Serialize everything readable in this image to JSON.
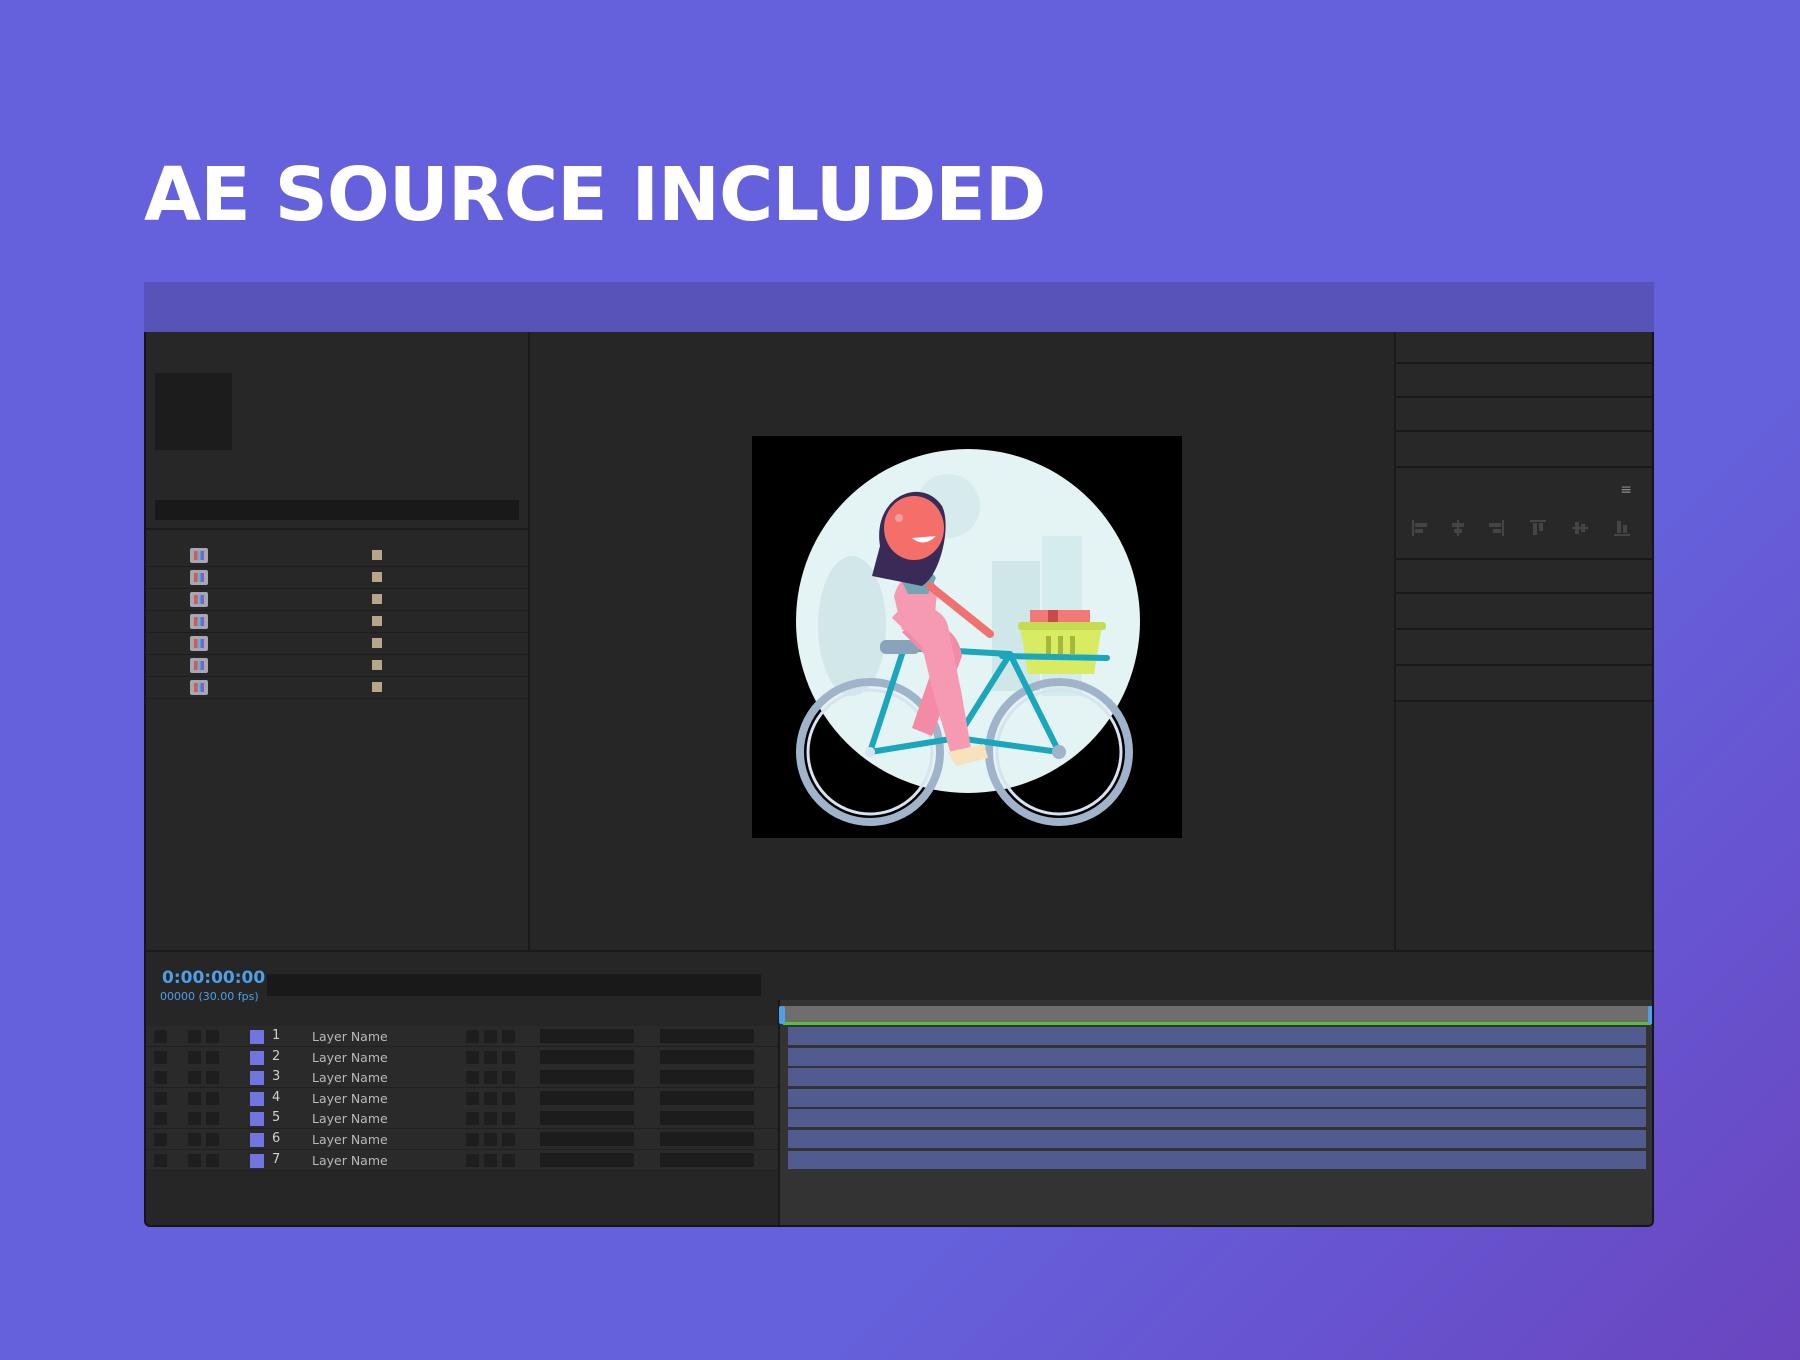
{
  "headline": "AE SOURCE INCLUDED",
  "colors": {
    "background": "#6561dc",
    "timecode": "#4d9fea",
    "layer_label": "#7175e0",
    "layer_bar": "#525b90",
    "work_area_line": "#5bbf3a"
  },
  "project_panel": {
    "items": [
      {
        "icon": "composition-icon"
      },
      {
        "icon": "composition-icon"
      },
      {
        "icon": "composition-icon"
      },
      {
        "icon": "composition-icon"
      },
      {
        "icon": "composition-icon"
      },
      {
        "icon": "composition-icon"
      },
      {
        "icon": "composition-icon"
      }
    ]
  },
  "right_panel": {
    "menu_icon": "≡"
  },
  "timeline": {
    "timecode": "0:00:00:00",
    "frames": "00000 (30.00 fps)",
    "layers": [
      {
        "num": "1",
        "name": "Layer Name"
      },
      {
        "num": "2",
        "name": "Layer Name"
      },
      {
        "num": "3",
        "name": "Layer Name"
      },
      {
        "num": "4",
        "name": "Layer Name"
      },
      {
        "num": "5",
        "name": "Layer Name"
      },
      {
        "num": "6",
        "name": "Layer Name"
      },
      {
        "num": "7",
        "name": "Layer Name"
      }
    ]
  }
}
